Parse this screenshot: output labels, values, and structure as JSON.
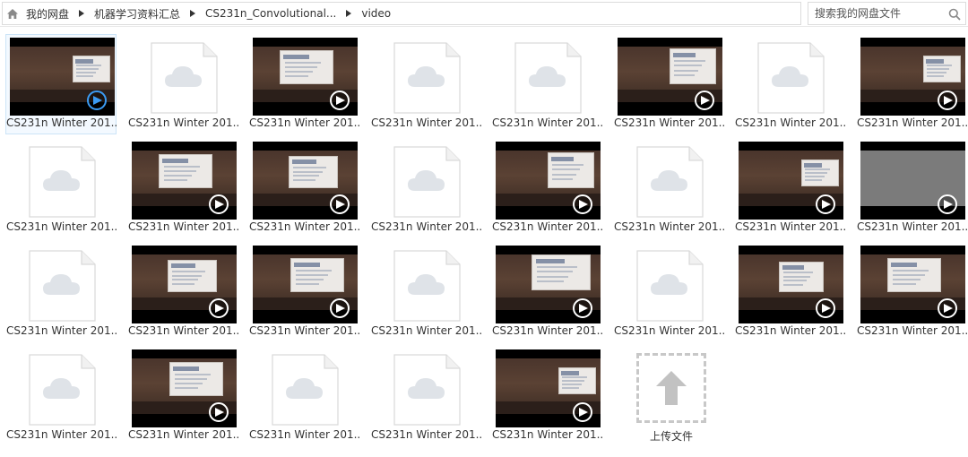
{
  "breadcrumb": {
    "items": [
      "我的网盘",
      "机器学习资料汇总",
      "CS231n_Convolutional...",
      "video"
    ]
  },
  "search": {
    "placeholder": "搜索我的网盘文件"
  },
  "files": [
    {
      "name": "CS231n Winter 201...",
      "kind": "video",
      "selected": true
    },
    {
      "name": "CS231n Winter 201...",
      "kind": "doc"
    },
    {
      "name": "CS231n Winter 201...",
      "kind": "video"
    },
    {
      "name": "CS231n Winter 201...",
      "kind": "doc"
    },
    {
      "name": "CS231n Winter 201...",
      "kind": "doc"
    },
    {
      "name": "CS231n Winter 201...",
      "kind": "video"
    },
    {
      "name": "CS231n Winter 201...",
      "kind": "doc"
    },
    {
      "name": "CS231n Winter 201...",
      "kind": "video"
    },
    {
      "name": "CS231n Winter 201...",
      "kind": "doc"
    },
    {
      "name": "CS231n Winter 201...",
      "kind": "video"
    },
    {
      "name": "CS231n Winter 201...",
      "kind": "video"
    },
    {
      "name": "CS231n Winter 201...",
      "kind": "doc"
    },
    {
      "name": "CS231n Winter 201...",
      "kind": "video"
    },
    {
      "name": "CS231n Winter 201...",
      "kind": "doc"
    },
    {
      "name": "CS231n Winter 201...",
      "kind": "video"
    },
    {
      "name": "CS231n Winter 201...",
      "kind": "video-gray"
    },
    {
      "name": "CS231n Winter 201...",
      "kind": "doc"
    },
    {
      "name": "CS231n Winter 201...",
      "kind": "video"
    },
    {
      "name": "CS231n Winter 201...",
      "kind": "video"
    },
    {
      "name": "CS231n Winter 201...",
      "kind": "doc"
    },
    {
      "name": "CS231n Winter 201...",
      "kind": "video"
    },
    {
      "name": "CS231n Winter 201...",
      "kind": "doc"
    },
    {
      "name": "CS231n Winter 201...",
      "kind": "video"
    },
    {
      "name": "CS231n Winter 201...",
      "kind": "video"
    },
    {
      "name": "CS231n Winter 201...",
      "kind": "doc"
    },
    {
      "name": "CS231n Winter 201...",
      "kind": "video"
    },
    {
      "name": "CS231n Winter 201...",
      "kind": "doc"
    },
    {
      "name": "CS231n Winter 201...",
      "kind": "doc"
    },
    {
      "name": "CS231n Winter 201...",
      "kind": "video"
    }
  ],
  "upload": {
    "label": "上传文件"
  },
  "colors": {
    "accent": "#3b9bf3",
    "cloud": "#dfe3e8",
    "doc_border": "#d9d9d9"
  }
}
